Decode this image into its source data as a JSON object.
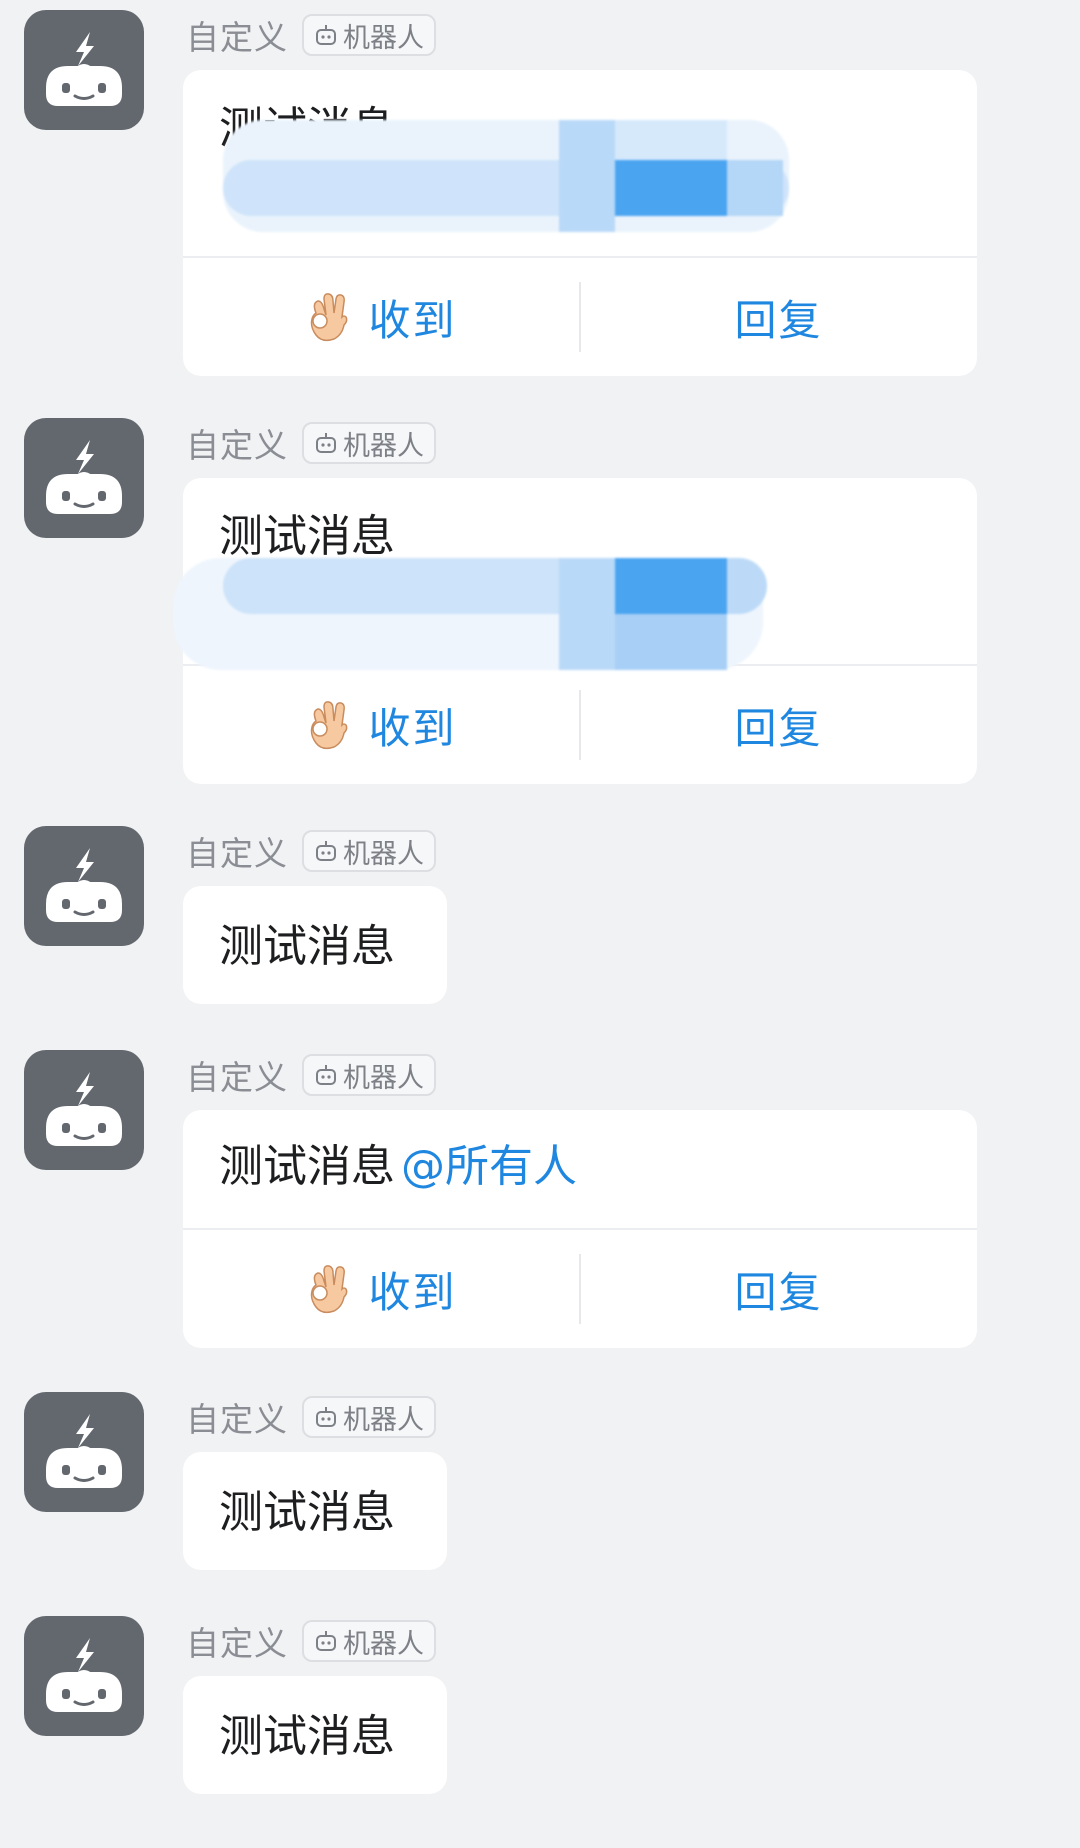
{
  "colors": {
    "background": "#f1f2f4",
    "avatar": "#63676e",
    "accent": "#1f87df",
    "bubble": "#ffffff"
  },
  "icons": {
    "avatar": "robot-icon",
    "tag": "robot-icon",
    "ack": "ok-hand-icon"
  },
  "messages": [
    {
      "sender": "自定义",
      "tag": "机器人",
      "text": "测试消息",
      "mention": "",
      "redacted": true,
      "actions": {
        "ack": "收到",
        "reply": "回复"
      }
    },
    {
      "sender": "自定义",
      "tag": "机器人",
      "text": "测试消息",
      "mention": "",
      "redacted": true,
      "actions": {
        "ack": "收到",
        "reply": "回复"
      }
    },
    {
      "sender": "自定义",
      "tag": "机器人",
      "text": "测试消息"
    },
    {
      "sender": "自定义",
      "tag": "机器人",
      "text": "测试消息",
      "mention": "@所有人",
      "redacted": false,
      "actions": {
        "ack": "收到",
        "reply": "回复"
      }
    },
    {
      "sender": "自定义",
      "tag": "机器人",
      "text": "测试消息"
    },
    {
      "sender": "自定义",
      "tag": "机器人",
      "text": "测试消息"
    }
  ]
}
